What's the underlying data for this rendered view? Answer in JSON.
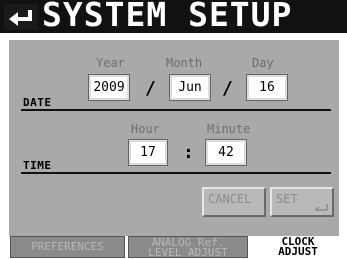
{
  "title": "SYSTEM SETUP",
  "date": {
    "section_label": "DATE",
    "year_label": "Year",
    "month_label": "Month",
    "day_label": "Day",
    "year": "2009",
    "month": "Jun",
    "day": "16",
    "separator": "/"
  },
  "time": {
    "section_label": "TIME",
    "hour_label": "Hour",
    "minute_label": "Minute",
    "hour": "17",
    "minute": "42",
    "separator": ":"
  },
  "buttons": {
    "cancel": "CANCEL",
    "set": "SET"
  },
  "tabs": {
    "preferences": "PREFERENCES",
    "analog_line1": "ANALOG Ref.",
    "analog_line2": "LEVEL ADJUST",
    "clock_line1": "CLOCK",
    "clock_line2": "ADJUST"
  },
  "icons": {
    "back": "back-arrow-icon"
  }
}
